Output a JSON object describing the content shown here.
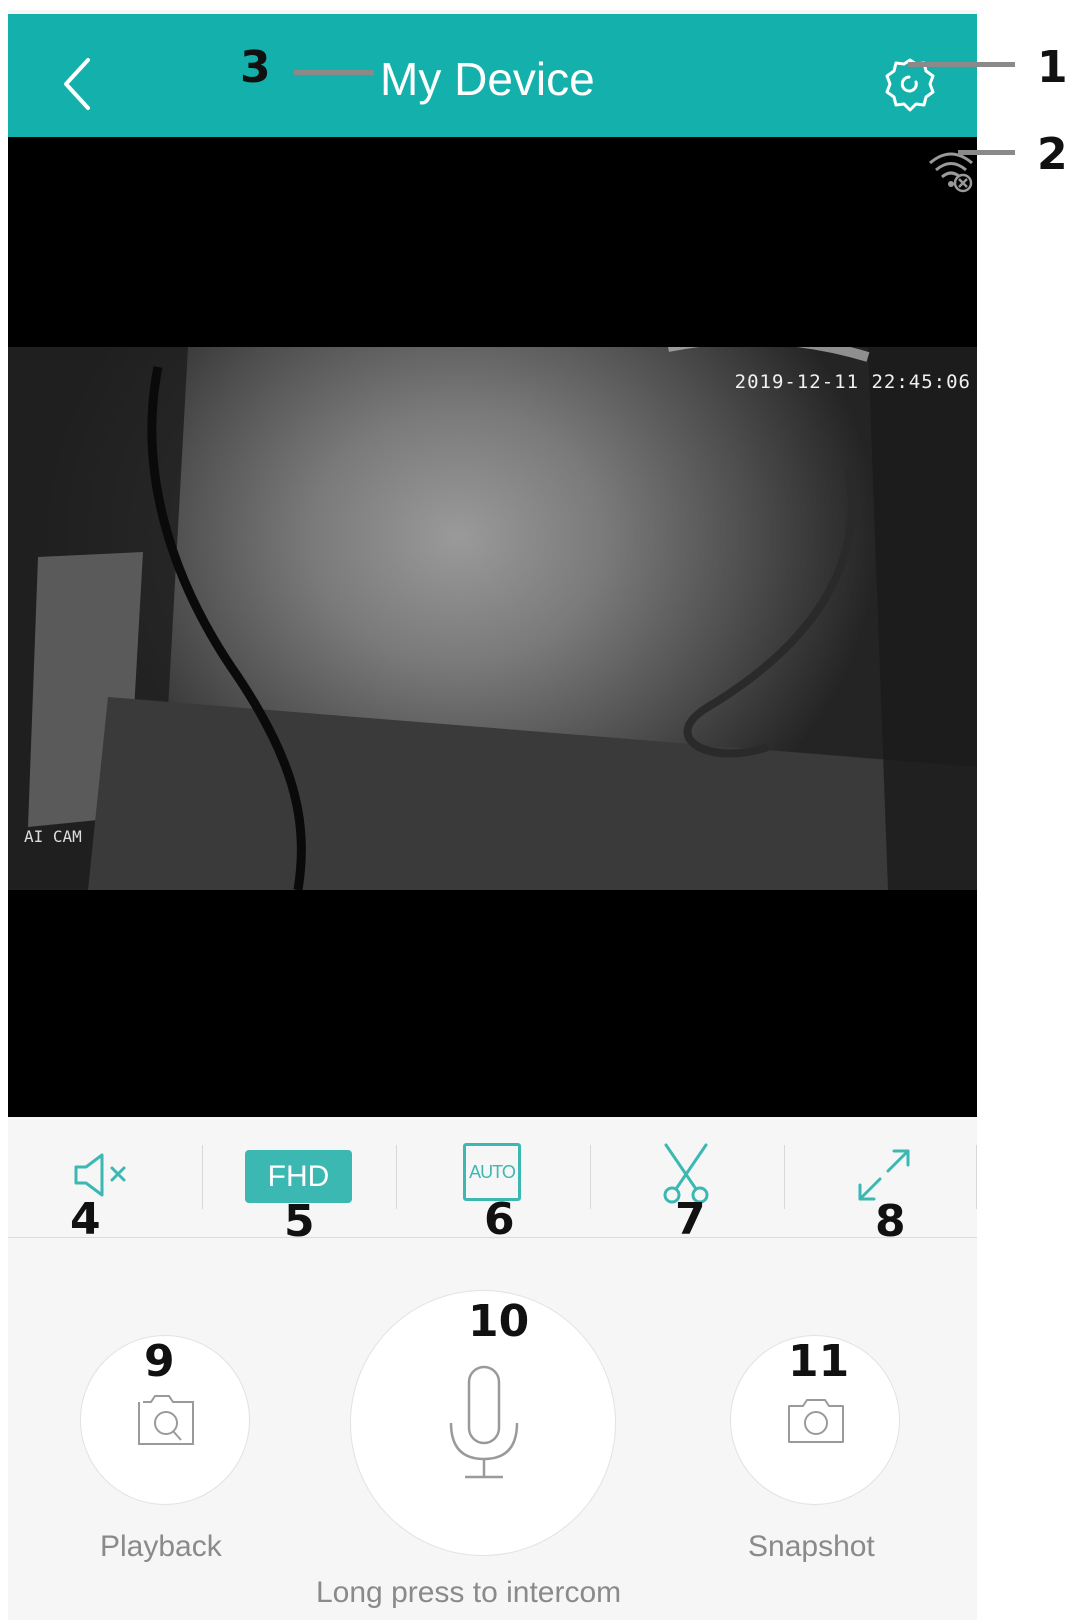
{
  "header": {
    "title": "My Device",
    "back_icon": "chevron-left-icon",
    "settings_icon": "gear-icon"
  },
  "video": {
    "timestamp": "2019-12-11 22:45:06",
    "camera_label": "AI CAM",
    "network_icon": "wifi-disconnected-icon"
  },
  "controls": {
    "mute_icon": "speaker-muted-icon",
    "quality_label": "FHD",
    "mode_label": "AUTO",
    "clip_icon": "scissors-icon",
    "fullscreen_icon": "expand-icon"
  },
  "actions": {
    "playback_label": "Playback",
    "intercom_label": "Long press to intercom",
    "snapshot_label": "Snapshot"
  },
  "callouts": [
    "1",
    "2",
    "3",
    "4",
    "5",
    "6",
    "7",
    "8",
    "9",
    "10",
    "11"
  ],
  "colors": {
    "accent": "#13b0ac",
    "button_accent": "#3cb8b2"
  }
}
